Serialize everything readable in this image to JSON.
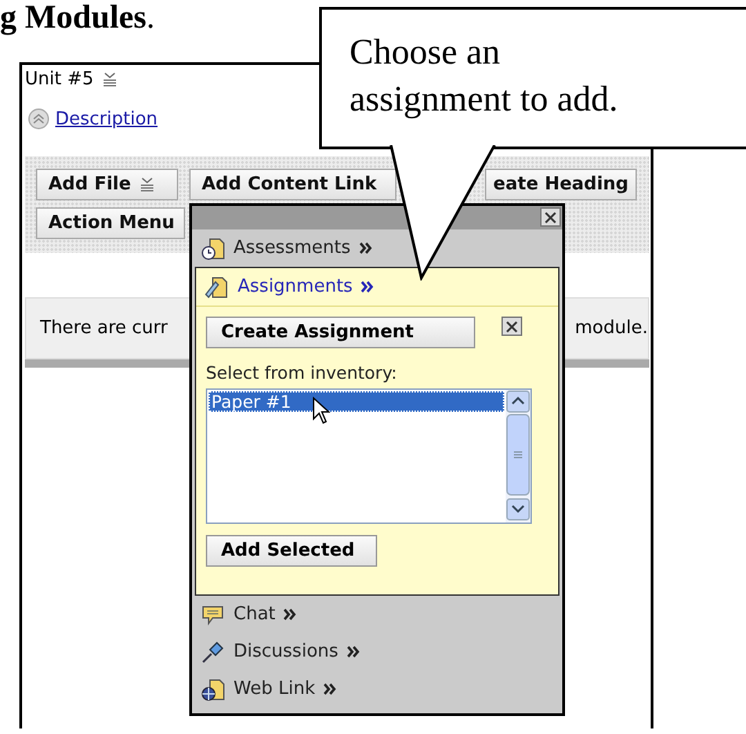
{
  "heading": "**g Modules**.",
  "callout": {
    "text": "Choose an assignment to add."
  },
  "module": {
    "title": "Unit #5",
    "description_link": "Description",
    "toolbar": [
      {
        "label": "Add File",
        "menu": true
      },
      {
        "label": "Add Content Link",
        "menu": false
      },
      {
        "label": "eate Heading",
        "menu": false
      }
    ],
    "action_menu": {
      "label": "Action Menu"
    },
    "notice": [
      "There are curr",
      "module."
    ]
  },
  "popup": {
    "items_before": [
      {
        "label": "Assessments",
        "kind": "assessment"
      }
    ],
    "active": {
      "label": "Assignments",
      "kind": "assignment",
      "create_button": "Create Assignment",
      "inventory_label": "Select from inventory:",
      "inventory": [
        {
          "label": "Paper #1",
          "selected": true
        }
      ],
      "add_button": "Add Selected"
    },
    "items_after": [
      {
        "label": "Chat",
        "kind": "chat"
      },
      {
        "label": "Discussions",
        "kind": "pin"
      },
      {
        "label": "Web Link",
        "kind": "weblink"
      }
    ]
  }
}
